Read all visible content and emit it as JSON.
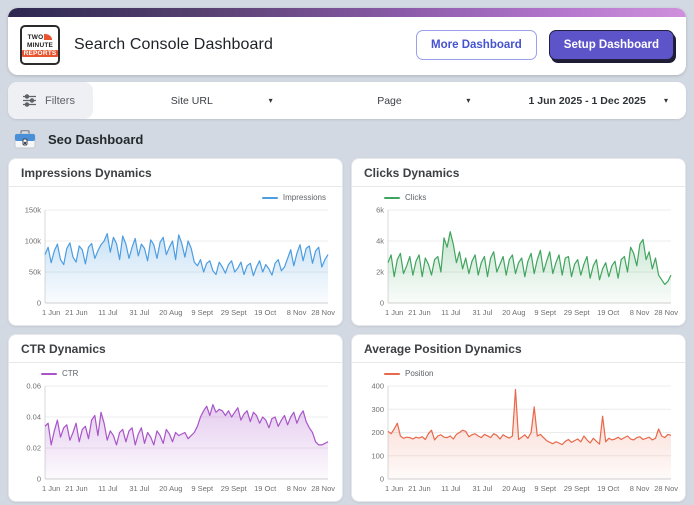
{
  "header": {
    "logo": {
      "line1": "TWO",
      "line2": "MINUTE",
      "line3": "REPORTS"
    },
    "title": "Search Console Dashboard",
    "more_button": "More Dashboard",
    "setup_button": "Setup Dashboard"
  },
  "filters": {
    "label": "Filters",
    "site_url_label": "Site URL",
    "page_label": "Page",
    "date_range": "1 Jun 2025 - 1 Dec 2025"
  },
  "section": {
    "title": "Seo Dashboard"
  },
  "colors": {
    "impressions": "#4d9de0",
    "clicks": "#41a55f",
    "ctr": "#a855c8",
    "position": "#e8684a",
    "accent_purple": "#5d54c9"
  },
  "chart_data": [
    {
      "type": "line",
      "title": "Impressions Dynamics",
      "legend": "Impressions",
      "legend_position": "right",
      "color": "#4d9de0",
      "ylim": [
        0,
        150000
      ],
      "yticks": [
        0,
        50000,
        100000,
        150000
      ],
      "ytick_labels": [
        "0",
        "50k",
        "100k",
        "150k"
      ],
      "x_tick_labels": [
        "1 Jun",
        "21 Jun",
        "11 Jul",
        "31 Jul",
        "20 Aug",
        "9 Sept",
        "29 Sept",
        "19 Oct",
        "8 Nov",
        "28 Nov"
      ],
      "x_range": [
        "1 Jun 2025",
        "1 Dec 2025"
      ],
      "values": [
        78000,
        90000,
        65000,
        84000,
        95000,
        70000,
        62000,
        88000,
        97000,
        74000,
        66000,
        92000,
        86000,
        63000,
        90000,
        96000,
        72000,
        84000,
        94000,
        100000,
        112000,
        82000,
        106000,
        96000,
        70000,
        108000,
        95000,
        72000,
        90000,
        104000,
        76000,
        95000,
        88000,
        68000,
        102000,
        94000,
        72000,
        98000,
        106000,
        78000,
        90000,
        100000,
        70000,
        110000,
        96000,
        74000,
        100000,
        88000,
        66000,
        60000,
        70000,
        50000,
        64000,
        68000,
        52000,
        46000,
        66000,
        58000,
        48000,
        62000,
        68000,
        50000,
        56000,
        66000,
        46000,
        60000,
        64000,
        44000,
        58000,
        68000,
        50000,
        62000,
        55000,
        45000,
        64000,
        70000,
        52000,
        58000,
        72000,
        86000,
        60000,
        80000,
        94000,
        68000,
        88000,
        92000,
        64000,
        84000,
        90000,
        58000,
        70000,
        78000
      ]
    },
    {
      "type": "line",
      "title": "Clicks Dynamics",
      "legend": "Clicks",
      "legend_position": "left",
      "color": "#41a55f",
      "ylim": [
        0,
        6000
      ],
      "yticks": [
        0,
        2000,
        4000,
        6000
      ],
      "ytick_labels": [
        "0",
        "2k",
        "4k",
        "6k"
      ],
      "x_tick_labels": [
        "1 Jun",
        "21 Jun",
        "11 Jul",
        "31 Jul",
        "20 Aug",
        "9 Sept",
        "29 Sept",
        "19 Oct",
        "8 Nov",
        "28 Nov"
      ],
      "x_range": [
        "1 Jun 2025",
        "1 Dec 2025"
      ],
      "values": [
        2600,
        3100,
        1700,
        2800,
        3200,
        1900,
        2400,
        3000,
        1800,
        2700,
        3100,
        1700,
        2900,
        2500,
        1800,
        2800,
        3000,
        2000,
        4200,
        3600,
        4600,
        3800,
        2600,
        3300,
        2200,
        2900,
        1900,
        2700,
        3100,
        1800,
        2600,
        3000,
        1700,
        2900,
        3300,
        2000,
        2500,
        3000,
        1800,
        2800,
        3100,
        1900,
        2600,
        2900,
        1700,
        2700,
        3200,
        1900,
        2800,
        3400,
        2000,
        2700,
        3300,
        1900,
        2600,
        3100,
        1800,
        2900,
        3000,
        1700,
        2500,
        2800,
        1800,
        2500,
        3000,
        1600,
        2400,
        2800,
        1500,
        2200,
        2600,
        1700,
        2400,
        2700,
        1600,
        2800,
        3000,
        2000,
        3600,
        3200,
        2400,
        3800,
        4100,
        2800,
        3300,
        2200,
        2900,
        1800,
        1500,
        1200,
        1400,
        1800
      ]
    },
    {
      "type": "line",
      "title": "CTR Dynamics",
      "legend": "CTR",
      "legend_position": "left",
      "color": "#a855c8",
      "ylim": [
        0,
        0.06
      ],
      "yticks": [
        0,
        0.02,
        0.04,
        0.06
      ],
      "ytick_labels": [
        "0",
        "0.02",
        "0.04",
        "0.06"
      ],
      "x_tick_labels": [
        "1 Jun",
        "21 Jun",
        "11 Jul",
        "31 Jul",
        "20 Aug",
        "9 Sept",
        "29 Sept",
        "19 Oct",
        "8 Nov",
        "28 Nov"
      ],
      "x_range": [
        "1 Jun 2025",
        "1 Dec 2025"
      ],
      "values": [
        0.034,
        0.036,
        0.022,
        0.031,
        0.038,
        0.027,
        0.033,
        0.035,
        0.025,
        0.03,
        0.036,
        0.024,
        0.032,
        0.034,
        0.026,
        0.038,
        0.041,
        0.028,
        0.043,
        0.036,
        0.025,
        0.031,
        0.028,
        0.022,
        0.03,
        0.032,
        0.024,
        0.031,
        0.033,
        0.022,
        0.029,
        0.033,
        0.023,
        0.03,
        0.027,
        0.022,
        0.031,
        0.028,
        0.023,
        0.032,
        0.029,
        0.024,
        0.03,
        0.028,
        0.029,
        0.03,
        0.026,
        0.028,
        0.03,
        0.034,
        0.04,
        0.044,
        0.047,
        0.041,
        0.048,
        0.043,
        0.045,
        0.044,
        0.041,
        0.044,
        0.04,
        0.043,
        0.046,
        0.038,
        0.042,
        0.044,
        0.037,
        0.043,
        0.041,
        0.036,
        0.04,
        0.038,
        0.033,
        0.039,
        0.04,
        0.034,
        0.038,
        0.041,
        0.035,
        0.04,
        0.043,
        0.036,
        0.041,
        0.044,
        0.037,
        0.033,
        0.03,
        0.024,
        0.022,
        0.022,
        0.023,
        0.024
      ]
    },
    {
      "type": "line",
      "title": "Average Position Dynamics",
      "legend": "Position",
      "legend_position": "left",
      "color": "#e8684a",
      "ylim": [
        0,
        400
      ],
      "yticks": [
        0,
        100,
        200,
        300,
        400
      ],
      "ytick_labels": [
        "0",
        "100",
        "200",
        "300",
        "400"
      ],
      "x_tick_labels": [
        "1 Jun",
        "21 Jun",
        "11 Jul",
        "31 Jul",
        "20 Aug",
        "9 Sept",
        "29 Sept",
        "19 Oct",
        "8 Nov",
        "28 Nov"
      ],
      "x_range": [
        "1 Jun 2025",
        "1 Dec 2025"
      ],
      "values": [
        205,
        195,
        215,
        240,
        185,
        175,
        180,
        178,
        172,
        180,
        176,
        182,
        170,
        195,
        210,
        168,
        185,
        190,
        180,
        178,
        185,
        172,
        192,
        200,
        210,
        205,
        182,
        190,
        195,
        185,
        178,
        192,
        186,
        178,
        195,
        188,
        172,
        190,
        182,
        176,
        185,
        385,
        170,
        180,
        190,
        175,
        200,
        310,
        185,
        192,
        178,
        165,
        158,
        152,
        160,
        155,
        148,
        162,
        170,
        158,
        165,
        172,
        160,
        185,
        168,
        155,
        175,
        162,
        150,
        270,
        160,
        175,
        168,
        172,
        180,
        170,
        178,
        185,
        172,
        168,
        178,
        182,
        170,
        175,
        180,
        168,
        175,
        215,
        185,
        178,
        192,
        188
      ]
    }
  ]
}
